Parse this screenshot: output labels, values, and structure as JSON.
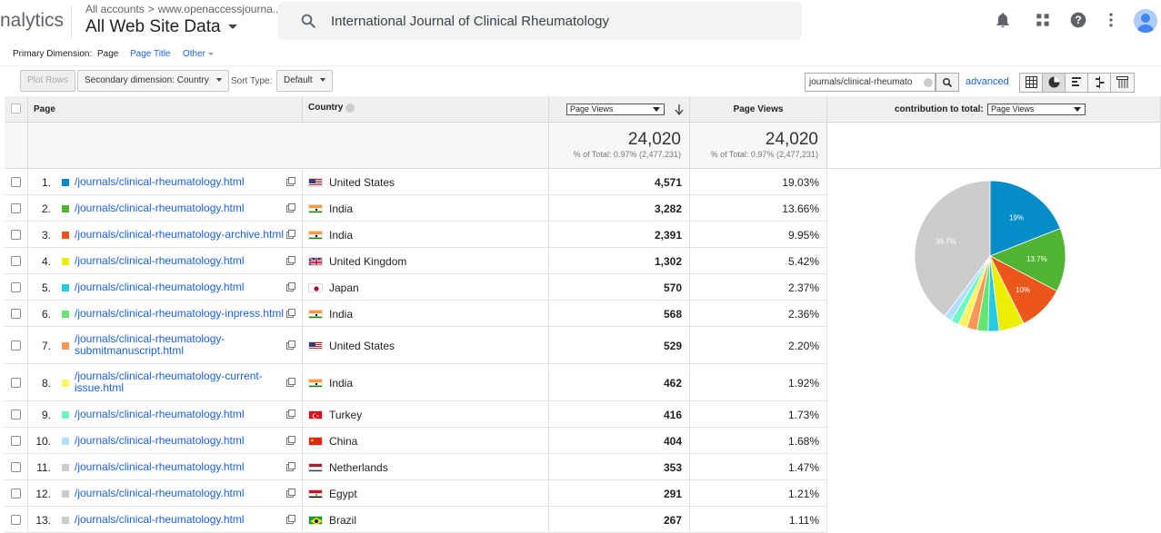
{
  "header": {
    "app_name": "nalytics",
    "breadcrumb_root": "All accounts",
    "breadcrumb_sep": ">",
    "breadcrumb_account": "www.openaccessjourna...",
    "property": "All Web Site Data",
    "search_text": "International Journal of Clinical Rheumatology"
  },
  "dimensions": {
    "label": "Primary Dimension:",
    "active": "Page",
    "page_title": "Page Title",
    "other": "Other"
  },
  "toolbar": {
    "plot_rows": "Plot Rows",
    "secondary_dimension": "Secondary dimension: Country",
    "sort_type_label": "Sort Type:",
    "sort_type": "Default",
    "filter_value": "journals/clinical-rheumato",
    "advanced": "advanced"
  },
  "table": {
    "col_page": "Page",
    "col_country": "Country",
    "col_metric_select": "Page Views",
    "col_page_views": "Page Views",
    "col_contribution": "contribution to total:",
    "contribution_select": "Page Views",
    "totals": {
      "views_left": "24,020",
      "pct_left": "% of Total: 0.97% (2,477,231)",
      "views_right": "24,020",
      "pct_right": "% of Total: 0.97% (2,477,231)"
    },
    "rows": [
      {
        "rank": "1.",
        "color": "#058dc7",
        "page": "/journals/clinical-rheumatology.html",
        "flag": "us",
        "country": "United States",
        "views": "4,571",
        "pct": "19.03%"
      },
      {
        "rank": "2.",
        "color": "#50b432",
        "page": "/journals/clinical-rheumatology.html",
        "flag": "in",
        "country": "India",
        "views": "3,282",
        "pct": "13.66%"
      },
      {
        "rank": "3.",
        "color": "#ed561b",
        "page": "/journals/clinical-rheumatology-archive.html",
        "flag": "in",
        "country": "India",
        "views": "2,391",
        "pct": "9.95%"
      },
      {
        "rank": "4.",
        "color": "#edef00",
        "page": "/journals/clinical-rheumatology.html",
        "flag": "uk",
        "country": "United Kingdom",
        "views": "1,302",
        "pct": "5.42%"
      },
      {
        "rank": "5.",
        "color": "#24cbe5",
        "page": "/journals/clinical-rheumatology.html",
        "flag": "jp",
        "country": "Japan",
        "views": "570",
        "pct": "2.37%"
      },
      {
        "rank": "6.",
        "color": "#64e572",
        "page": "/journals/clinical-rheumatology-inpress.html",
        "flag": "in",
        "country": "India",
        "views": "568",
        "pct": "2.36%"
      },
      {
        "rank": "7.",
        "color": "#ff9655",
        "page": "/journals/clinical-rheumatology-submitmanuscript.html",
        "flag": "us",
        "country": "United States",
        "views": "529",
        "pct": "2.20%"
      },
      {
        "rank": "8.",
        "color": "#fff263",
        "page": "/journals/clinical-rheumatology-current-issue.html",
        "flag": "in",
        "country": "India",
        "views": "462",
        "pct": "1.92%"
      },
      {
        "rank": "9.",
        "color": "#6af9c4",
        "page": "/journals/clinical-rheumatology.html",
        "flag": "tr",
        "country": "Turkey",
        "views": "416",
        "pct": "1.73%"
      },
      {
        "rank": "10.",
        "color": "#b2deff",
        "page": "/journals/clinical-rheumatology.html",
        "flag": "cn",
        "country": "China",
        "views": "404",
        "pct": "1.68%"
      },
      {
        "rank": "11.",
        "color": "#cccccc",
        "page": "/journals/clinical-rheumatology.html",
        "flag": "nl",
        "country": "Netherlands",
        "views": "353",
        "pct": "1.47%"
      },
      {
        "rank": "12.",
        "color": "#cccccc",
        "page": "/journals/clinical-rheumatology.html",
        "flag": "eg",
        "country": "Egypt",
        "views": "291",
        "pct": "1.21%"
      },
      {
        "rank": "13.",
        "color": "#cccccc",
        "page": "/journals/clinical-rheumatology.html",
        "flag": "br",
        "country": "Brazil",
        "views": "267",
        "pct": "1.11%"
      }
    ]
  },
  "chart_data": {
    "type": "pie",
    "title": "",
    "categories": [
      "1",
      "2",
      "3",
      "4",
      "5",
      "6",
      "7",
      "8",
      "9",
      "10",
      "other"
    ],
    "values": [
      19.03,
      13.66,
      9.95,
      5.42,
      2.37,
      2.36,
      2.2,
      1.92,
      1.73,
      1.68,
      39.68
    ],
    "colors": [
      "#058dc7",
      "#50b432",
      "#ed561b",
      "#edef00",
      "#24cbe5",
      "#64e572",
      "#ff9655",
      "#fff263",
      "#6af9c4",
      "#b2deff",
      "#cccccc"
    ],
    "slice_labels": [
      "19%",
      "13.7%",
      "10%",
      "",
      "",
      "",
      "",
      "",
      "",
      "",
      "39.7%"
    ]
  }
}
